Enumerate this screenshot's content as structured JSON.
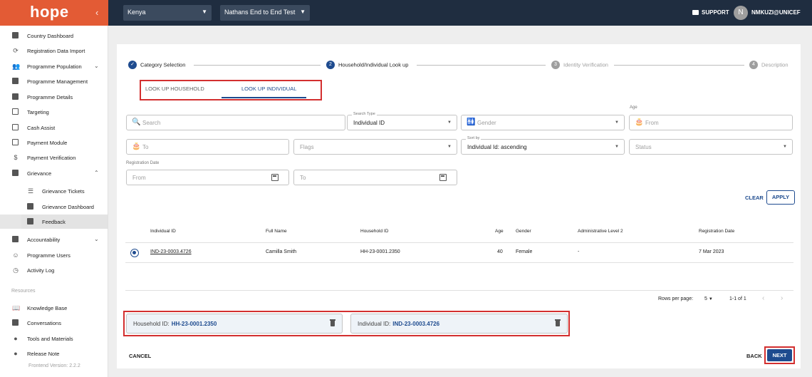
{
  "app": {
    "logo": "hope"
  },
  "topbar": {
    "country": "Kenya",
    "programme": "Nathans End to End Test",
    "support": "SUPPORT",
    "avatar_initial": "N",
    "user": "NMKUZI@UNICEF"
  },
  "sidebar": {
    "items": [
      {
        "label": "Country Dashboard"
      },
      {
        "label": "Registration Data Import"
      },
      {
        "label": "Programme Population"
      },
      {
        "label": "Programme Management"
      },
      {
        "label": "Programme Details"
      },
      {
        "label": "Targeting"
      },
      {
        "label": "Cash Assist"
      },
      {
        "label": "Payment Module"
      },
      {
        "label": "Payment Verification"
      },
      {
        "label": "Grievance"
      },
      {
        "label": "Grievance Tickets"
      },
      {
        "label": "Grievance Dashboard"
      },
      {
        "label": "Feedback"
      },
      {
        "label": "Accountability"
      },
      {
        "label": "Programme Users"
      },
      {
        "label": "Activity Log"
      }
    ],
    "resources_label": "Resources",
    "resources": [
      {
        "label": "Knowledge Base"
      },
      {
        "label": "Conversations"
      },
      {
        "label": "Tools and Materials"
      },
      {
        "label": "Release Note"
      }
    ],
    "version": "Frontend Version: 2.2.2"
  },
  "stepper": {
    "steps": [
      {
        "number": "1",
        "label": "Category Selection"
      },
      {
        "number": "2",
        "label": "Household/Individual Look up"
      },
      {
        "number": "3",
        "label": "Identity Verification"
      },
      {
        "number": "4",
        "label": "Description"
      }
    ]
  },
  "tabs": {
    "household": "LOOK UP HOUSEHOLD",
    "individual": "LOOK UP INDIVIDUAL"
  },
  "filters": {
    "search_placeholder": "Search",
    "search_type_label": "Search Type",
    "search_type_value": "Individual ID",
    "gender_placeholder": "Gender",
    "age_label": "Age",
    "age_from": "From",
    "age_to": "To",
    "flags_placeholder": "Flags",
    "sort_by_label": "Sort by",
    "sort_by_value": "Individual Id: ascending",
    "status_placeholder": "Status",
    "registration_date_label": "Registration Date",
    "reg_from": "From",
    "reg_to": "To",
    "clear": "CLEAR",
    "apply": "APPLY"
  },
  "table": {
    "headers": [
      "Individual ID",
      "Full Name",
      "Household ID",
      "Age",
      "Gender",
      "Administrative Level 2",
      "Registration Date"
    ],
    "rows": [
      {
        "individual_id": "IND-23-0003.4726",
        "full_name": "Camilla Smith",
        "household_id": "HH-23-0001.2350",
        "age": "40",
        "gender": "Female",
        "admin2": "-",
        "registration_date": "7 Mar 2023"
      }
    ]
  },
  "pagination": {
    "rows_per_page_label": "Rows per page:",
    "rows_per_page": "5",
    "range": "1-1 of 1"
  },
  "selection": {
    "household_label": "Household ID:",
    "household_value": "HH-23-0001.2350",
    "individual_label": "Individual ID:",
    "individual_value": "IND-23-0003.4726"
  },
  "footer": {
    "cancel": "CANCEL",
    "back": "BACK",
    "next": "NEXT"
  },
  "colors": {
    "topbar": "#1f2d40",
    "logo_bg": "#e35b35",
    "primary": "#1e4b8f",
    "highlight": "#d32f2f"
  }
}
